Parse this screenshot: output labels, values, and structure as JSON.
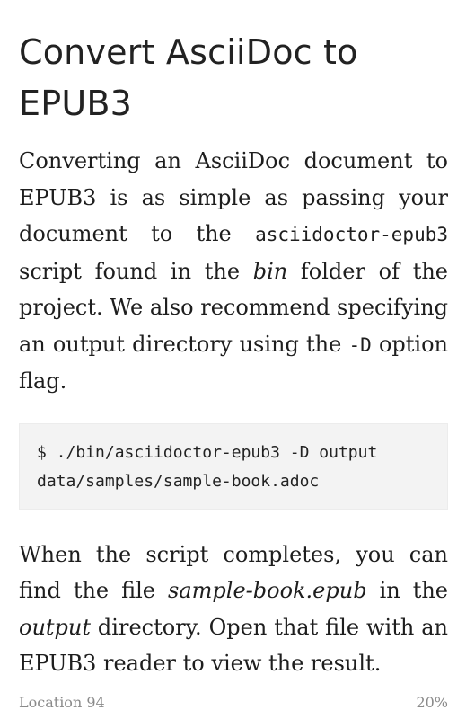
{
  "heading": "Convert AsciiDoc to EPUB3",
  "para1": {
    "t1": "Converting an AsciiDoc document to EPUB3 is as simple as passing your document to the ",
    "code1": "asciidoctor-epub3",
    "t2": " script found in the ",
    "em1": "bin",
    "t3": " folder of the project. We also recommend specifying an output directory using the ",
    "code2": "-D",
    "t4": " option flag."
  },
  "listing": {
    "line1": "$ ./bin/asciidoctor-epub3 -D output",
    "line2": "data/samples/sample-book.adoc"
  },
  "para2": {
    "t1": "When the script completes, you can find the file ",
    "em1": "sample-book.epub",
    "t2": " in the ",
    "em2": "output",
    "t3": " directory. Open that file with an EPUB3 reader to view the result."
  },
  "footer": {
    "location": "Location 94",
    "progress": "20%"
  }
}
